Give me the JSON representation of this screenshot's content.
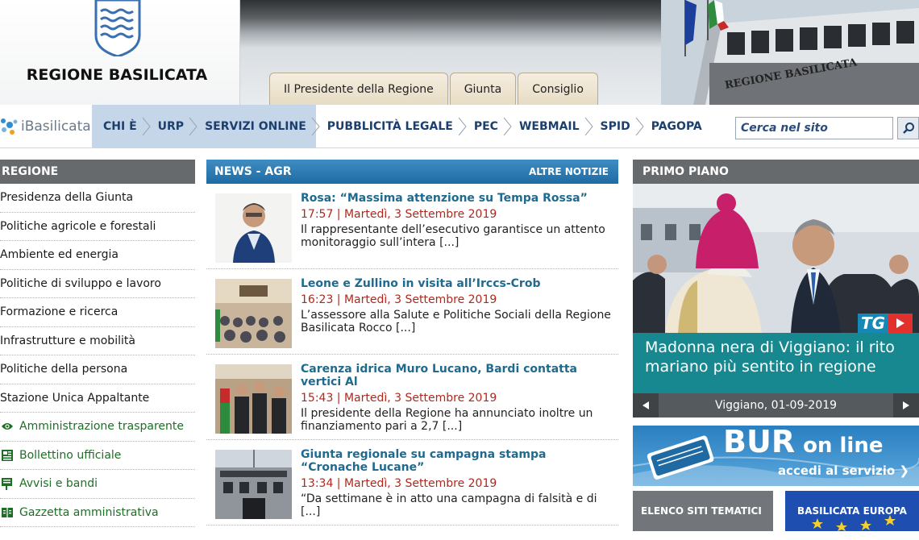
{
  "header": {
    "region_name": "REGIONE BASILICATA",
    "building_sign": "REGIONE BASILICATA",
    "tabs": [
      {
        "label": "Il Presidente della Regione"
      },
      {
        "label": "Giunta"
      },
      {
        "label": "Consiglio"
      }
    ]
  },
  "nav": {
    "brand": "iBasilicata",
    "items": [
      {
        "label": "CHI È"
      },
      {
        "label": "URP"
      },
      {
        "label": "SERVIZI ONLINE"
      },
      {
        "label": "PUBBLICITÀ LEGALE"
      },
      {
        "label": "PEC"
      },
      {
        "label": "WEBMAIL"
      },
      {
        "label": "SPID"
      },
      {
        "label": "PAGOPA"
      }
    ],
    "search_placeholder": "Cerca nel sito"
  },
  "sidebar": {
    "title": "REGIONE",
    "items": [
      {
        "label": "Presidenza della Giunta"
      },
      {
        "label": "Politiche agricole e forestali"
      },
      {
        "label": "Ambiente ed energia"
      },
      {
        "label": "Politiche di sviluppo e lavoro"
      },
      {
        "label": "Formazione e ricerca"
      },
      {
        "label": "Infrastrutture e mobilità"
      },
      {
        "label": "Politiche della persona"
      },
      {
        "label": "Stazione Unica Appaltante"
      }
    ],
    "links": [
      {
        "label": "Amministrazione trasparente",
        "icon": "eye-icon"
      },
      {
        "label": "Bollettino ufficiale",
        "icon": "newspaper-icon"
      },
      {
        "label": "Avvisi e bandi",
        "icon": "notice-icon"
      },
      {
        "label": "Gazzetta amministrativa",
        "icon": "book-icon"
      }
    ]
  },
  "news": {
    "title": "NEWS - AGR",
    "more": "ALTRE NOTIZIE",
    "items": [
      {
        "title": "Rosa: “Massima attenzione su Tempa Rossa”",
        "date": "17:57 | Martedì, 3 Settembre 2019",
        "excerpt": "Il rappresentante dell’esecutivo garantisce un attento monitoraggio sull’intera [...]"
      },
      {
        "title": "Leone e Zullino in visita all’Irccs-Crob",
        "date": "16:23 | Martedì, 3 Settembre 2019",
        "excerpt": "L’assessore alla Salute e Politiche Sociali della Regione Basilicata Rocco [...]"
      },
      {
        "title": "Carenza idrica Muro Lucano, Bardi contatta vertici Al",
        "date": "15:43 | Martedì, 3 Settembre 2019",
        "excerpt": "Il presidente della Regione ha annunciato inoltre un finanziamento pari a 2,7 [...]"
      },
      {
        "title": "Giunta regionale su campagna stampa “Cronache Lucane”",
        "date": "13:34 | Martedì, 3 Settembre 2019",
        "excerpt": "“Da settimane è in atto una campagna di falsità e di [...]"
      }
    ]
  },
  "primo_piano": {
    "title": "PRIMO PIANO",
    "badge": "TG",
    "caption": "Madonna nera di Viggiano: il rito mariano più sentito in regione",
    "date": "Viggiano, 01-09-2019"
  },
  "bur": {
    "title_a": "BUR",
    "title_b": "on line",
    "subtitle": "accedi al servizio ❯"
  },
  "tiles": {
    "siti": "ELENCO SITI TEMATICI",
    "europa": "BASILICATA EUROPA"
  }
}
